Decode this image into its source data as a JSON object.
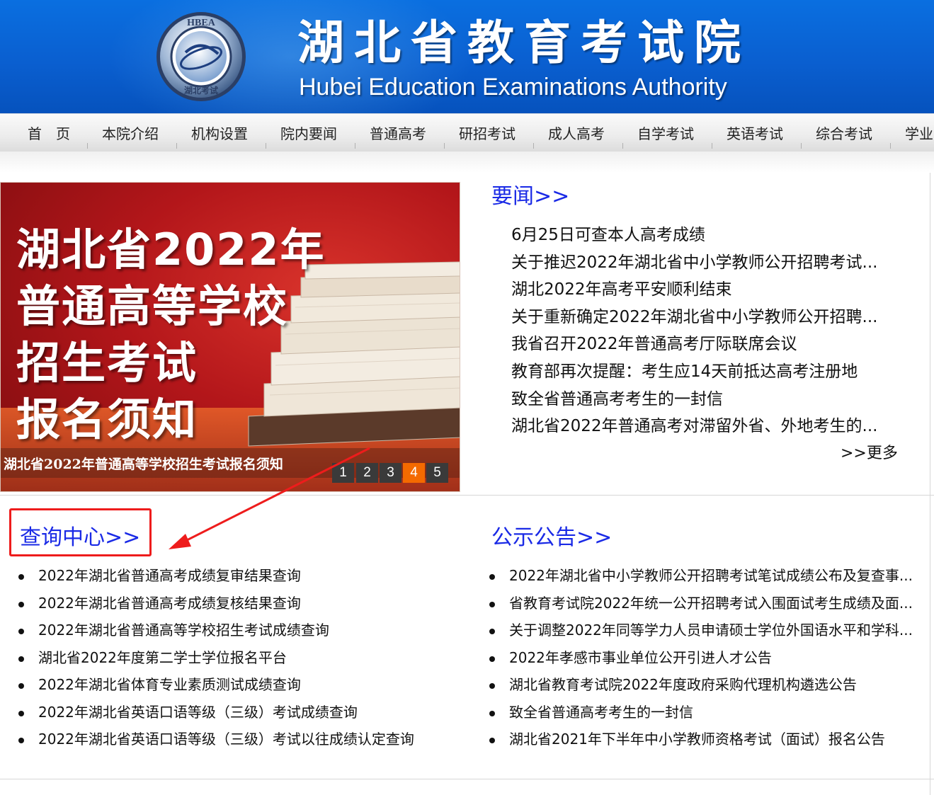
{
  "header": {
    "emblem_text": "HBEA",
    "emblem_ring_text": "湖北考试",
    "title": "湖北省教育考试院",
    "subtitle": "Hubei Education Examinations Authority"
  },
  "nav": {
    "items": [
      "首　页",
      "本院介绍",
      "机构设置",
      "院内要闻",
      "普通高考",
      "研招考试",
      "成人高考",
      "自学考试",
      "英语考试",
      "综合考试",
      "学业"
    ]
  },
  "slider": {
    "lines": [
      "湖北省2022年",
      "普通高等学校",
      "招生考试",
      "报名须知"
    ],
    "caption": "湖北省2022年普通高等学校招生考试报名须知",
    "pages": [
      "1",
      "2",
      "3",
      "4",
      "5"
    ],
    "active_page": "4"
  },
  "news": {
    "title": "要闻>>",
    "items": [
      "6月25日可查本人高考成绩",
      "关于推迟2022年湖北省中小学教师公开招聘考试...",
      "湖北2022年高考平安顺利结束",
      "关于重新确定2022年湖北省中小学教师公开招聘...",
      "我省召开2022年普通高考厅际联席会议",
      "教育部再次提醒：考生应14天前抵达高考注册地",
      "致全省普通高考考生的一封信",
      "湖北省2022年普通高考对滞留外省、外地考生的..."
    ],
    "more": ">>更多"
  },
  "query": {
    "title": "查询中心>>",
    "items": [
      "2022年湖北省普通高考成绩复审结果查询",
      "2022年湖北省普通高考成绩复核结果查询",
      "2022年湖北省普通高等学校招生考试成绩查询",
      "湖北省2022年度第二学士学位报名平台",
      "2022年湖北省体育专业素质测试成绩查询",
      "2022年湖北省英语口语等级（三级）考试成绩查询",
      "2022年湖北省英语口语等级（三级）考试以往成绩认定查询"
    ]
  },
  "notice": {
    "title": "公示公告>>",
    "items": [
      "2022年湖北省中小学教师公开招聘考试笔试成绩公布及复查事...",
      "省教育考试院2022年统一公开招聘考试入围面试考生成绩及面...",
      "关于调整2022年同等学力人员申请硕士学位外国语水平和学科...",
      "2022年孝感市事业单位公开引进人才公告",
      "湖北省教育考试院2022年度政府采购代理机构遴选公告",
      "致全省普通高考考生的一封信",
      "湖北省2021年下半年中小学教师资格考试（面试）报名公告"
    ]
  },
  "colors": {
    "header_blue": "#0a5fd0",
    "link_blue": "#1a2ae6",
    "annotation_red": "#ee1c1c",
    "pager_active": "#f46a00"
  }
}
